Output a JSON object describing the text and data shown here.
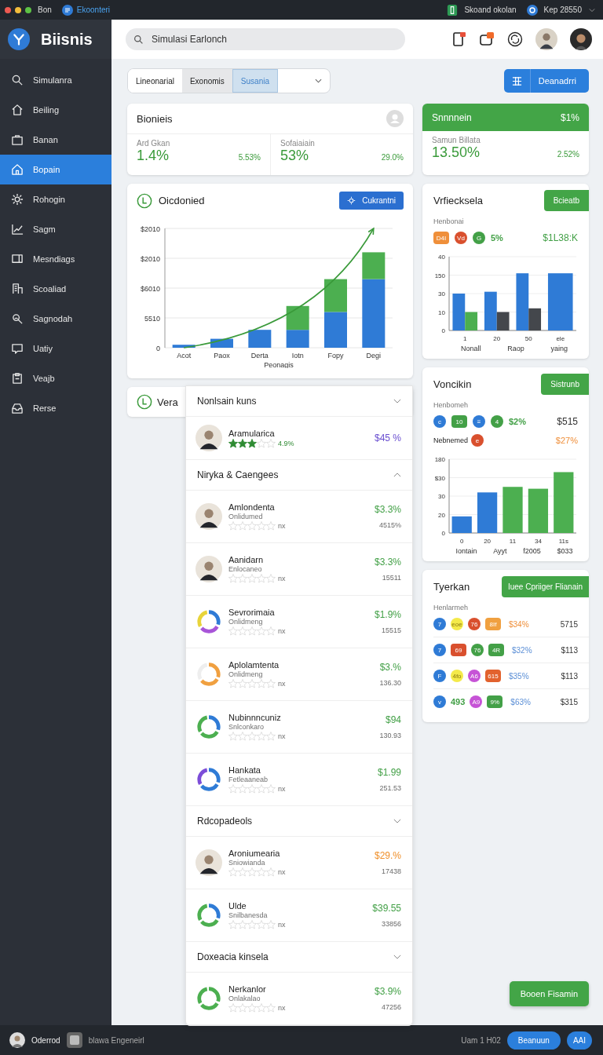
{
  "system_bar": {
    "app": "Bon",
    "app_title": "Ekoonteri",
    "status": "Skoand okolan",
    "account": "Kep 28550"
  },
  "brand": {
    "name": "Biisnis"
  },
  "sidebar": {
    "items": [
      {
        "label": "Simulanra",
        "selected": false
      },
      {
        "label": "Beiling",
        "selected": false
      },
      {
        "label": "Banan",
        "selected": false
      },
      {
        "label": "Bopain",
        "selected": true
      },
      {
        "label": "Rohogin",
        "selected": false
      },
      {
        "label": "Sagm",
        "selected": false
      },
      {
        "label": "Mesndiags",
        "selected": false
      },
      {
        "label": "Scoaliad",
        "selected": false
      },
      {
        "label": "Sagnodah",
        "selected": false
      },
      {
        "label": "Uatiy",
        "selected": false
      },
      {
        "label": "Veajb",
        "selected": false
      },
      {
        "label": "Rerse",
        "selected": false
      }
    ]
  },
  "search": {
    "placeholder": "Simulasi Earlonch"
  },
  "segments": [
    {
      "label": "Lineonarial",
      "selected": false,
      "pressed": false
    },
    {
      "label": "Exonomis",
      "selected": false,
      "pressed": true
    },
    {
      "label": "Susania",
      "selected": true,
      "pressed": false
    }
  ],
  "primary_button": {
    "label": "Deanadrri"
  },
  "summary_card": {
    "title": "Bionieis",
    "stats": [
      {
        "label": "Ard Gkan",
        "value": "1.4%",
        "change": "5.53%"
      },
      {
        "label": "Sofaiaiain",
        "value": "53%",
        "change": "29.0%"
      }
    ]
  },
  "highlight_card": {
    "title": "Snnnnein",
    "value": "$1%",
    "label": "Samun Billata",
    "big": "13.50%",
    "change": "2.52%"
  },
  "main_chart_card": {
    "title": "Oicdonied",
    "button": "Cukrantni",
    "y_axis_labels": [
      "$2010",
      "$2010",
      "$6010",
      "5510",
      "0"
    ],
    "x_labels": [
      "Acot",
      "Paox",
      "Derta",
      "Iotn",
      "Fopy",
      "Degi"
    ],
    "xlabel": "Peonagis"
  },
  "second_card": {
    "title": "Vera"
  },
  "list_panel": {
    "sections": [
      {
        "title": "Nonlsain kuns",
        "expanded": false,
        "items": [
          {
            "kind": "avatar",
            "name": "Aramularica",
            "stars": 3,
            "rating": "4.9%",
            "value": "$45 %",
            "color": "#6a4fd0"
          }
        ]
      },
      {
        "title": "Niryka & Caengees",
        "expanded": true,
        "items": [
          {
            "kind": "avatar",
            "name": "Amlondenta",
            "subtitle": "Onlidumed",
            "stars": 0,
            "rating": "nx",
            "value": "$3.3%",
            "amount": "4515%",
            "color": "#43a047"
          },
          {
            "kind": "avatar",
            "name": "Aanidarn",
            "subtitle": "Enlocaneo",
            "stars": 0,
            "rating": "nx",
            "value": "$3.3%",
            "amount": "15511",
            "color": "#43a047"
          },
          {
            "kind": "ring",
            "name": "Sevrorimaia",
            "subtitle": "Onlidmeng",
            "stars": 0,
            "rating": "nx",
            "value": "$1.9%",
            "amount": "15515",
            "color": "#43a047"
          },
          {
            "kind": "ring",
            "name": "Aplolamtenta",
            "subtitle": "Onlidmeng",
            "stars": 0,
            "rating": "nx",
            "value": "$3.%",
            "amount": "136.30",
            "color": "#43a047"
          },
          {
            "kind": "ring",
            "name": "Nubinnncuniz",
            "subtitle": "Snlconkaro",
            "stars": 0,
            "rating": "nx",
            "value": "$94",
            "amount": "130.93",
            "color": "#43a047"
          },
          {
            "kind": "ring",
            "name": "Hankata",
            "subtitle": "Fetleaaneab",
            "stars": 0,
            "rating": "nx",
            "value": "$1.99",
            "amount": "251.53",
            "color": "#43a047"
          }
        ]
      },
      {
        "title": "Rdcopadeols",
        "expanded": false,
        "items": [
          {
            "kind": "avatar",
            "name": "Aroniumearia",
            "subtitle": "Sniowianda",
            "stars": 0,
            "rating": "nx",
            "value": "$29.%",
            "amount": "17438",
            "color": "#ef8f2a"
          },
          {
            "kind": "ring",
            "name": "Ulde",
            "subtitle": "Snilbanesda",
            "stars": 0,
            "rating": "nx",
            "value": "$39.55",
            "amount": "33856",
            "color": "#43a047"
          }
        ]
      },
      {
        "title": "Doxeacia kinsela",
        "expanded": false,
        "items": [
          {
            "kind": "ring",
            "name": "Nerkanlor",
            "subtitle": "Onlakalao",
            "stars": 0,
            "rating": "nx",
            "value": "$3.9%",
            "amount": "47256",
            "color": "#43a047"
          }
        ]
      }
    ]
  },
  "right_cards": [
    {
      "title": "Vrfiecksela",
      "button": "Bcieatb",
      "subtitle": "Henbonai",
      "chips": [
        {
          "kind": "pill",
          "text": "D4I",
          "color": "#ef8f3a"
        },
        {
          "kind": "dot",
          "text": "Vd",
          "color": "#d9502e"
        },
        {
          "kind": "dot",
          "text": "G",
          "color": "#43a047"
        },
        {
          "kind": "text",
          "text": "5%",
          "color": "#43a047"
        }
      ],
      "amount": {
        "text": "$1L38:K",
        "color": "#43a047"
      },
      "y_axis_labels": [
        "40",
        "150",
        "30",
        "10",
        "0"
      ],
      "x_labels": [
        "1",
        "20",
        "50",
        "ele"
      ],
      "axis_notes": [
        "Nonall",
        "Raop",
        "yaing"
      ]
    },
    {
      "title": "Voncikin",
      "button": "Sistrunb",
      "subtitle": "Henbomeh",
      "chips": [
        {
          "kind": "dot",
          "text": "c",
          "color": "#2f7bd6"
        },
        {
          "kind": "pill",
          "text": "10",
          "color": "#43a047"
        },
        {
          "kind": "dot",
          "text": "≡",
          "color": "#2f7bd6"
        },
        {
          "kind": "dot",
          "text": "4",
          "color": "#43a047"
        },
        {
          "kind": "text",
          "text": "$2%",
          "color": "#43a047"
        }
      ],
      "amount": {
        "text": "$515",
        "color": "#333333"
      },
      "note": {
        "label": "Nebnemed",
        "chip": {
          "text": "e",
          "color": "#d9502e"
        },
        "value": {
          "text": "$27%",
          "color": "#ef8f3a"
        }
      },
      "y_axis_labels": [
        "180",
        "$30",
        "30",
        "20",
        "0"
      ],
      "x_labels": [
        "0",
        "20",
        "11",
        "34",
        "11s"
      ],
      "axis_notes": [
        "Iontain",
        "Ayyt",
        "f2005",
        "$033"
      ]
    }
  ],
  "table_card": {
    "title": "Tyerkan",
    "button": "Iuee Cpriiger Flianain",
    "subtitle": "Henlarmeh",
    "rows": [
      {
        "chips": [
          {
            "kind": "dot",
            "text": "7",
            "color": "#2f7bd6"
          },
          {
            "kind": "dot",
            "text": "eoe",
            "color": "#f4ea4a"
          },
          {
            "kind": "dot",
            "text": "76",
            "color": "#d9502e"
          },
          {
            "kind": "pill",
            "text": "8If",
            "color": "#f0a040"
          }
        ],
        "pct": {
          "text": "$34%",
          "color": "#ef8f3a"
        },
        "amount": "5715"
      },
      {
        "chips": [
          {
            "kind": "dot",
            "text": "7",
            "color": "#2f7bd6"
          },
          {
            "kind": "pill",
            "text": "69",
            "color": "#d9502e"
          },
          {
            "kind": "dot",
            "text": "76",
            "color": "#43a047"
          },
          {
            "kind": "pill",
            "text": "4R",
            "color": "#43a047"
          }
        ],
        "pct": {
          "text": "$32%",
          "color": "#5b8fd6"
        },
        "amount": "$113"
      },
      {
        "chips": [
          {
            "kind": "dot",
            "text": "F",
            "color": "#2f7bd6"
          },
          {
            "kind": "dot",
            "text": "4fo",
            "color": "#f4ea4a"
          },
          {
            "kind": "dot",
            "text": "A6",
            "color": "#c653d6"
          },
          {
            "kind": "pill",
            "text": "615",
            "color": "#e2622e"
          }
        ],
        "pct": {
          "text": "$35%",
          "color": "#5b8fd6"
        },
        "amount": "$113"
      },
      {
        "chips": [
          {
            "kind": "dot",
            "text": "v",
            "color": "#2f7bd6"
          },
          {
            "kind": "text",
            "text": "493",
            "color": "#43a047"
          },
          {
            "kind": "dot",
            "text": "A9",
            "color": "#c653d6"
          },
          {
            "kind": "pill",
            "text": "9%",
            "color": "#43a047"
          }
        ],
        "pct": {
          "text": "$63%",
          "color": "#5b8fd6"
        },
        "amount": "$315"
      }
    ]
  },
  "floating_button": {
    "label": "Booen Fisamin"
  },
  "bottom_bar": {
    "user": "Oderrod",
    "workspace": "blawa Engeneirl",
    "time": "Uam 1 H02",
    "button": "Beanuun",
    "action": "AAI"
  }
}
